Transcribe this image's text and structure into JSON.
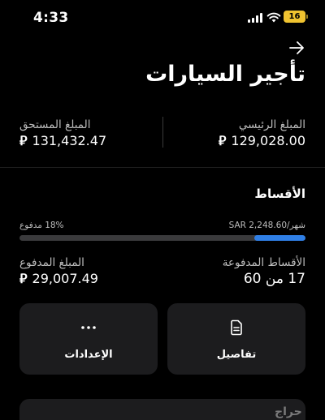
{
  "status_bar": {
    "time": "4:33",
    "battery": "16"
  },
  "header": {
    "title": "تأجير السيارات"
  },
  "currency_symbol": "⃁",
  "amounts": {
    "principal": {
      "label": "المبلغ الرئيسي",
      "value": "129,028.00"
    },
    "due": {
      "label": "المبلغ المستحق",
      "value": "131,432.47"
    }
  },
  "installments": {
    "title": "الأقساط",
    "monthly": "SAR 2,248.60/شهر",
    "paid_percent_text": "18% مدفوع",
    "progress_fraction": 0.18,
    "paid_installments": {
      "label": "الأقساط المدفوعة",
      "value": "17 من 60"
    },
    "paid_amount": {
      "label": "المبلغ المدفوع",
      "value": "29,007.49"
    }
  },
  "cards": {
    "details": {
      "label": "تفاصيل",
      "icon": "document-icon"
    },
    "settings": {
      "label": "الإعدادات",
      "icon": "more-dots-icon"
    }
  },
  "watermark": "حراج",
  "colors": {
    "accent": "#2f7fe6",
    "card": "#1c1c1e",
    "battery": "#f0c330"
  }
}
